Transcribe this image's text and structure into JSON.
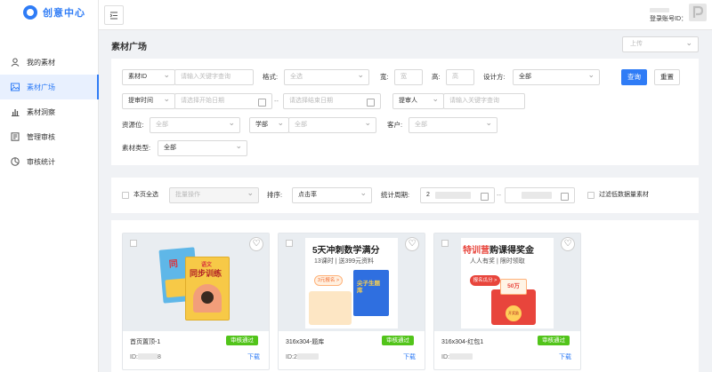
{
  "app": {
    "logo_text": "创意中心"
  },
  "sidebar": {
    "items": [
      {
        "label": "我的素材",
        "icon": "user-icon"
      },
      {
        "label": "素材广场",
        "icon": "image-icon",
        "active": true
      },
      {
        "label": "素材洞察",
        "icon": "bar-chart-icon"
      },
      {
        "label": "管理审核",
        "icon": "audit-icon"
      },
      {
        "label": "审核统计",
        "icon": "pie-chart-icon"
      }
    ]
  },
  "topbar": {
    "account_label": "登录账号ID："
  },
  "page": {
    "title": "素材广场",
    "upload_placeholder": "上传"
  },
  "filters": {
    "material_id_select": "素材ID",
    "material_id_placeholder": "请输入关键字查询",
    "format_label": "格式:",
    "format_value": "全选",
    "width_label": "宽:",
    "width_placeholder": "宽",
    "height_label": "高:",
    "height_placeholder": "高",
    "designer_label": "设计方:",
    "designer_value": "全部",
    "query_button": "查询",
    "reset_button": "重置",
    "submit_time_select": "提审时间",
    "start_date_placeholder": "请选择开始日期",
    "date_separator": "--",
    "end_date_placeholder": "请选择结束日期",
    "submitter_select": "提审人",
    "submitter_placeholder": "请输入关键字查询",
    "resource_label": "资源位:",
    "resource_value": "全部",
    "dept_select": "学部",
    "dept_value": "全部",
    "client_label": "客户:",
    "client_value": "全部",
    "type_label": "素材类型:",
    "type_value": "全部"
  },
  "toolbar": {
    "select_all_label": "本页全选",
    "batch_placeholder": "批量操作",
    "sort_label": "排序:",
    "sort_value": "点击率",
    "period_label": "统计周期:",
    "period_start": "2",
    "period_sep": "--",
    "filter_low_label": "过滤低数据量素材"
  },
  "cards": [
    {
      "name": "首页置顶-1",
      "status": "审核通过",
      "id_prefix": "ID:",
      "id_suffix": "8",
      "download": "下载",
      "art": {
        "badge_text": "语文",
        "title": "同步训练"
      }
    },
    {
      "name": "316x304-题库",
      "status": "审核通过",
      "id_prefix": "ID:",
      "id_suffix": "2",
      "download": "下载",
      "art": {
        "headline": "5天冲刺数学满分",
        "sub": "13课时 | 送399元资料",
        "button": "3元报名 >",
        "book": "尖子生题库"
      }
    },
    {
      "name": "316x304-红包1",
      "status": "审核通过",
      "id_prefix": "ID:",
      "id_suffix": "",
      "download": "下载",
      "art": {
        "headline_accent": "特训营",
        "headline_rest": "购课得奖金",
        "sub": "人人有奖 | 限时领取",
        "button": "报名瓜分 >",
        "amount": "50万",
        "envelope": "开奖励"
      }
    }
  ],
  "colors": {
    "accent": "#2f7cf6",
    "success": "#52c41a",
    "hot_red": "#e8453c"
  }
}
